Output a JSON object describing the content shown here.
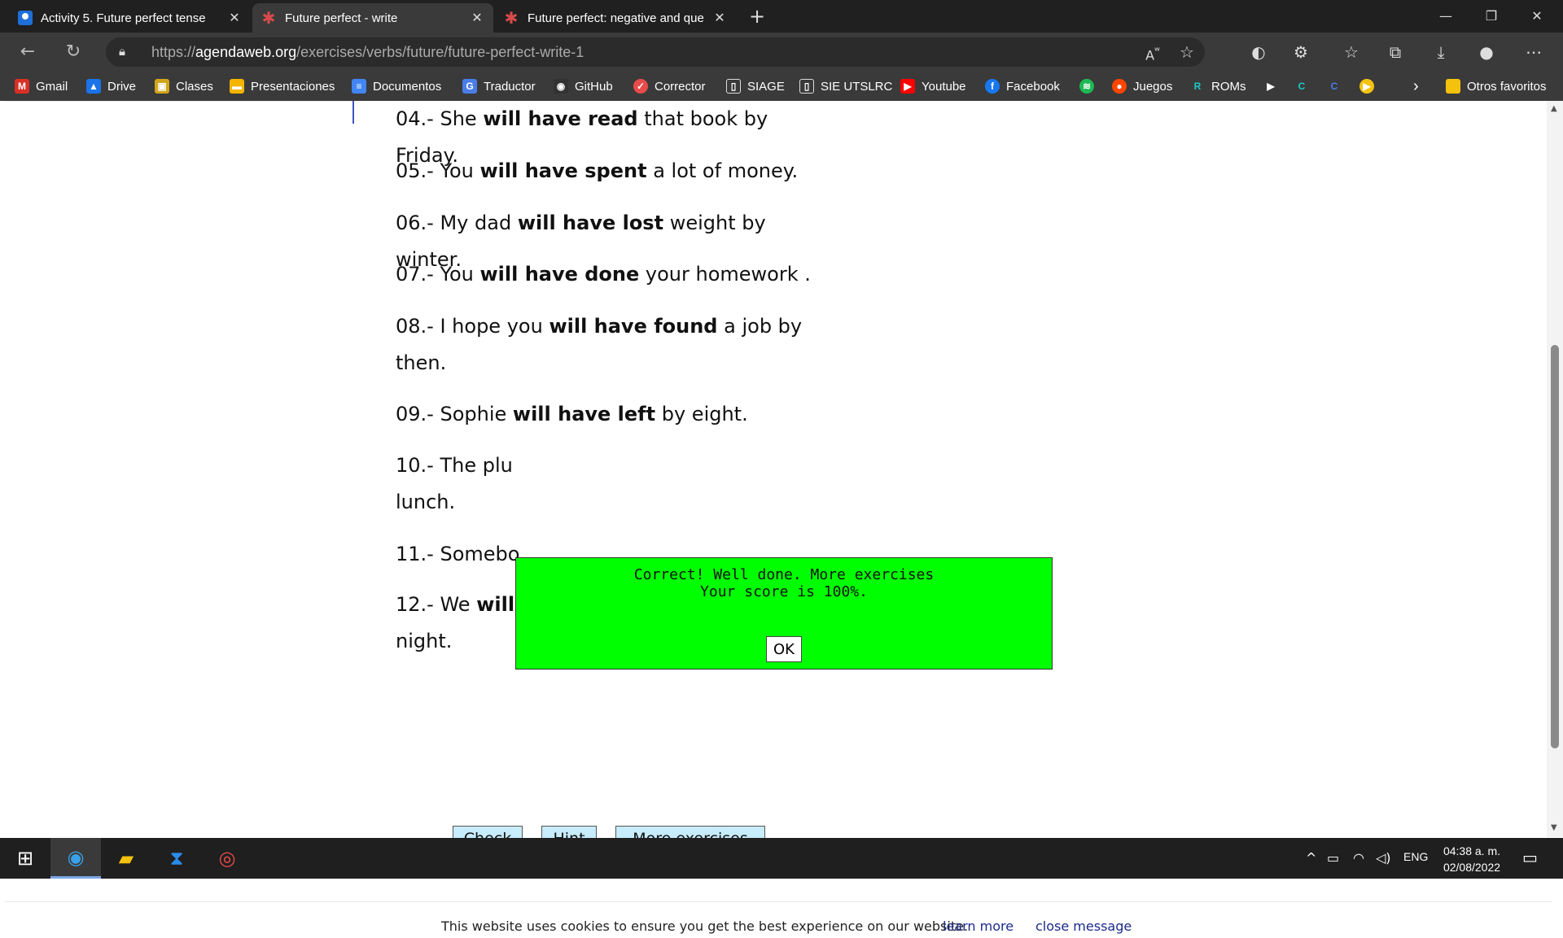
{
  "tabs": [
    {
      "title": "Activity 5. Future perfect tense",
      "close": "✕"
    },
    {
      "title": "Future perfect - write",
      "close": "✕"
    },
    {
      "title": "Future perfect: negative and que",
      "close": "✕"
    }
  ],
  "new_tab": "+",
  "window_controls": {
    "minimize": "—",
    "restore": "❐",
    "close": "✕"
  },
  "address_bar": {
    "url_prefix": "https://",
    "url_host": "agendaweb.org",
    "url_path": "/exercises/verbs/future/future-perfect-write-1"
  },
  "bookmarks": [
    {
      "label": "Gmail",
      "icon_letter": "M",
      "color": "#d93025"
    },
    {
      "label": "Drive",
      "icon_letter": "▲",
      "color": "#1a73e8"
    },
    {
      "label": "Clases",
      "icon_letter": "▣",
      "color": "#d1a51b"
    },
    {
      "label": "Presentaciones",
      "icon_letter": "▬",
      "color": "#f4b400"
    },
    {
      "label": "Documentos",
      "icon_letter": "≡",
      "color": "#4285f4"
    },
    {
      "label": "Traductor",
      "icon_letter": "G",
      "color": "#4a7de8"
    },
    {
      "label": "GitHub",
      "icon_letter": "◉",
      "color": "#333"
    },
    {
      "label": "Corrector",
      "icon_letter": "✓",
      "color": "#e94b4b"
    },
    {
      "label": "SIAGE",
      "icon_letter": "▯",
      "color": "#3a3a3a"
    },
    {
      "label": "SIE UTSLRC",
      "icon_letter": "▯",
      "color": "#3a3a3a"
    },
    {
      "label": "Youtube",
      "icon_letter": "▶",
      "color": "#ff0000"
    },
    {
      "label": "Facebook",
      "icon_letter": "f",
      "color": "#1877f2"
    },
    {
      "label": "",
      "icon_letter": "≋",
      "color": "#1db954"
    },
    {
      "label": "Juegos",
      "icon_letter": "●",
      "color": "#ff4500"
    },
    {
      "label": "ROMs",
      "icon_letter": "R",
      "color": "#1c8c8c"
    }
  ],
  "other_favorites": "Otros favoritos",
  "exercise_items": [
    {
      "num": "04.-",
      "pre": "She",
      "bold": "will have read",
      "post": "that book by Friday."
    },
    {
      "num": "05.-",
      "pre": "You",
      "bold": "will have spent",
      "post": "a lot of money."
    },
    {
      "num": "06.-",
      "pre": "My dad",
      "bold": "will have lost",
      "post": "weight by winter."
    },
    {
      "num": "07.-",
      "pre": "You",
      "bold": "will have done",
      "post": "your homework ."
    },
    {
      "num": "08.-",
      "pre": "I hope you",
      "bold": "will have found",
      "post": "a job by then."
    },
    {
      "num": "09.-",
      "pre": "Sophie",
      "bold": "will have left",
      "post": "by eight."
    },
    {
      "num": "10.-",
      "pre": "The plu",
      "bold": "",
      "post": "lunch."
    },
    {
      "num": "11.-",
      "pre": "Somebo",
      "bold": "",
      "post": ""
    },
    {
      "num": "12.-",
      "pre": "We",
      "bold": "will have caught",
      "post": "some fish before night."
    }
  ],
  "dialog": {
    "line1": "Correct! Well done. More exercises",
    "line2": "Your score is 100%.",
    "ok": "OK"
  },
  "buttons": {
    "check": "Check",
    "hint": "Hint",
    "more": "More exercises =>"
  },
  "cookie": {
    "text": "This website uses cookies to ensure you get the best experience on our website.",
    "learn": "learn more",
    "close": "close message"
  },
  "taskbar": {
    "lang": "ENG",
    "time": "04:38 a. m.",
    "date": "02/08/2022"
  }
}
